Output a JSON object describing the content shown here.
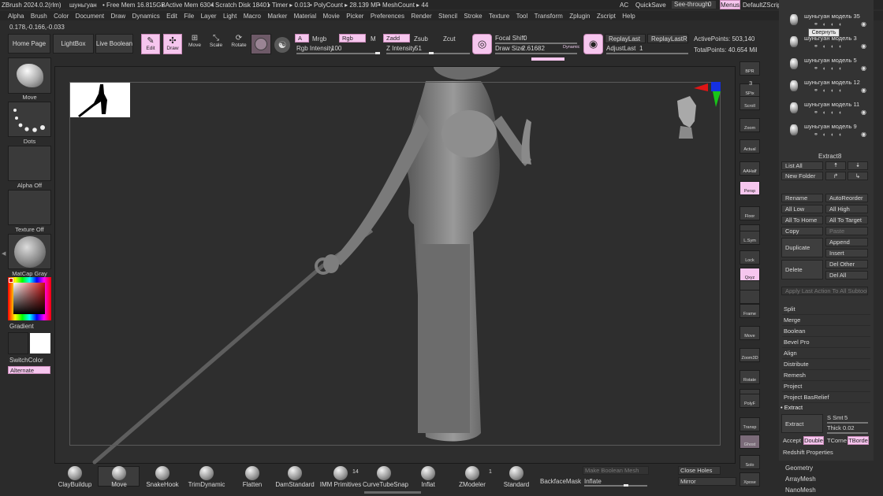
{
  "titlebar": {
    "app": "ZBrush 2024.0.2(rlm)",
    "doc": "шуньгуан",
    "free_mem": "• Free Mem 16.815GB",
    "active_mem": "• Active Mem 6304",
    "scratch": "• Scratch Disk 18401",
    "timer": "• Timer ▸ 0.013",
    "polycount": "• PolyCount ▸ 28.139 MP",
    "meshcount": "• MeshCount ▸ 44",
    "ac": "AC",
    "quicksave": "QuickSave",
    "see_through_label": "See-through",
    "see_through_value": "0",
    "menus": "Menus",
    "script": "DefaultZScript"
  },
  "menubar": [
    "Alpha",
    "Brush",
    "Color",
    "Document",
    "Draw",
    "Dynamics",
    "Edit",
    "File",
    "Layer",
    "Light",
    "Macro",
    "Marker",
    "Material",
    "Movie",
    "Picker",
    "Preferences",
    "Render",
    "Stencil",
    "Stroke",
    "Texture",
    "Tool",
    "Transform",
    "Zplugin",
    "Zscript",
    "Help"
  ],
  "coords": "0.178,-0.166,-0.033",
  "toolbar": {
    "home_page": "Home Page",
    "lightbox": "LightBox",
    "live_boolean": "Live Boolean",
    "edit": "Edit",
    "draw": "Draw",
    "move": "Move",
    "scale": "Scale",
    "rotate": "Rotate",
    "a": "A",
    "mrgb": "Mrgb",
    "rgb": "Rgb",
    "m": "M",
    "zadd": "Zadd",
    "zsub": "Zsub",
    "zcut": "Zcut",
    "rgb_intensity_label": "Rgb Intensity",
    "rgb_intensity_value": "100",
    "z_intensity_label": "Z Intensity",
    "z_intensity_value": "51",
    "focal_shift_label": "Focal Shift",
    "focal_shift_value": "0",
    "draw_size_label": "Draw Size",
    "draw_size_value": "2.61682",
    "dynamic": "Dynamic",
    "replaylast": "ReplayLast",
    "replaylastrel": "ReplayLastRel",
    "adjustlast_label": "AdjustLast",
    "adjustlast_value": "1",
    "active_points": "ActivePoints: 503,140",
    "total_points": "TotalPoints: 40.654 Mil"
  },
  "left_panel": {
    "move": "Move",
    "dots": "Dots",
    "alpha_off": "Alpha Off",
    "texture_off": "Texture Off",
    "matcap": "MatCap Gray",
    "gradient": "Gradient",
    "switchcolor": "SwitchColor",
    "alternate": "Alternate"
  },
  "right_shelf": [
    "BPR",
    "SPix",
    "Scroll",
    "Zoom",
    "Actual",
    "AAHalf",
    "Persp",
    "Floor",
    "Dynamic",
    "L.Sym",
    "Lock",
    "Qxyz",
    "",
    "",
    "Frame",
    "Move",
    "Zoom3D",
    "Rotate",
    "Line Fill",
    "PolyF",
    "Transp",
    "Ghost",
    "Solo",
    "Xpose"
  ],
  "spix_value": "3",
  "subtool": {
    "items": [
      {
        "name": "шуньгуан модель 35",
        "tooltip": "Свернуть"
      },
      {
        "name": "шуньгуан модель 3"
      },
      {
        "name": "шуньгуан модель 5"
      },
      {
        "name": "шуньгуан модель 12"
      },
      {
        "name": "шуньгуан модель 11"
      },
      {
        "name": "шуньгуан модель 9"
      }
    ],
    "current": "Extract8",
    "list_all": "List All",
    "new_folder": "New Folder",
    "rename": "Rename",
    "autoreorder": "AutoReorder",
    "all_low": "All Low",
    "all_high": "All High",
    "all_to_home": "All To Home",
    "all_to_target": "All To Target",
    "copy": "Copy",
    "paste": "Paste",
    "append": "Append",
    "duplicate": "Duplicate",
    "insert": "Insert",
    "delete": "Delete",
    "del_other": "Del Other",
    "del_all": "Del All",
    "apply_last": "Apply Last Action To All Subtools",
    "split": "Split",
    "merge": "Merge",
    "boolean": "Boolean",
    "bevel_pro": "Bevel Pro",
    "align": "Align",
    "distribute": "Distribute",
    "remesh": "Remesh",
    "project": "Project",
    "project_basrelief": "Project BasRelief",
    "extract_header": "Extract",
    "extract": "Extract",
    "s_smt_label": "S Smt",
    "s_smt_value": "5",
    "thick_label": "Thick",
    "thick_value": "0.02",
    "accept": "Accept",
    "double": "Double",
    "tcorne": "TCorne",
    "tborde": "TBorde",
    "redshift": "Redshift Properties",
    "geometry": "Geometry",
    "arraymesh": "ArrayMesh",
    "nanomesh": "NanoMesh"
  },
  "bottom_bar": {
    "brushes": [
      "ClayBuildup",
      "Move",
      "SnakeHook",
      "TrimDynamic",
      "Flatten",
      "DamStandard",
      "IMM Primitives",
      "CurveTubeSnap",
      "Inflat",
      "ZModeler",
      "Standard"
    ],
    "imm_count": "14",
    "zmodeler_count": "1",
    "backfacemask": "BackfaceMask",
    "make_boolean_mesh": "Make Boolean Mesh",
    "inflate": "Inflate",
    "close_holes": "Close Holes",
    "mirror": "Mirror"
  },
  "colors": {
    "accent_pink": "#f6c6ee",
    "panel_bg": "#2b2b2b",
    "viewport_bg": "#2e2e2e"
  }
}
